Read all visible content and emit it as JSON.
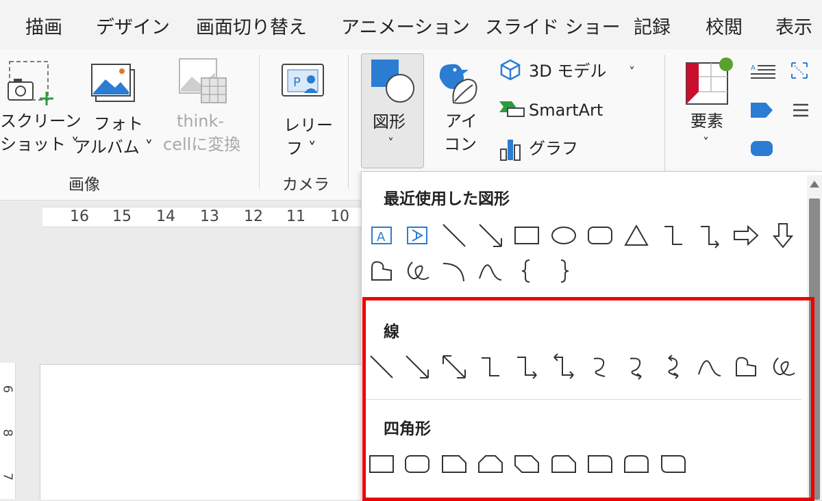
{
  "menu": {
    "tabs": [
      "描画",
      "デザイン",
      "画面切り替え",
      "アニメーション",
      "スライド ショー",
      "記録",
      "校閲",
      "表示"
    ]
  },
  "ribbon": {
    "screenshot": {
      "line1": "スクリーン",
      "line2": "ショット ˅"
    },
    "photo_album": {
      "line1": "フォト",
      "line2": "アルバム ˅"
    },
    "thinkcell": {
      "line1": "think-",
      "line2": "cellに変換"
    },
    "images_group": "画像",
    "relief": {
      "line1": "レリー",
      "line2": "フ ˅"
    },
    "camera_group": "カメラ",
    "shapes": {
      "label": "図形",
      "chevron": "˅"
    },
    "icons": {
      "line1": "アイ",
      "line2": "コン"
    },
    "model3d": {
      "label": "3D モデル",
      "chevron": "˅"
    },
    "smartart": "SmartArt",
    "chart": "グラフ",
    "elements": {
      "label": "要素",
      "chevron": "˅"
    }
  },
  "ruler": {
    "numbers": [
      "16",
      "15",
      "14",
      "13",
      "12",
      "11",
      "10"
    ],
    "vertical": [
      "6",
      "8",
      "7"
    ]
  },
  "shapes_panel": {
    "recent_title": "最近使用した図形",
    "lines_title": "線",
    "rect_title": "四角形"
  },
  "colors": {
    "highlight": "#ee0000",
    "accent_blue": "#2b7cd3",
    "elements_dot": "#5aa02c"
  }
}
